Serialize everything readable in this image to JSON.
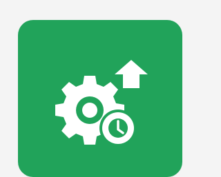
{
  "app": {
    "icon_name": "gear-clock-upgrade-icon",
    "tile_color": "#21a35a",
    "glyph_color": "#ffffff",
    "background_color": "#f4f4f4"
  },
  "icons": {
    "gear": "gear-icon",
    "clock": "clock-icon",
    "arrow": "arrow-up-icon"
  }
}
